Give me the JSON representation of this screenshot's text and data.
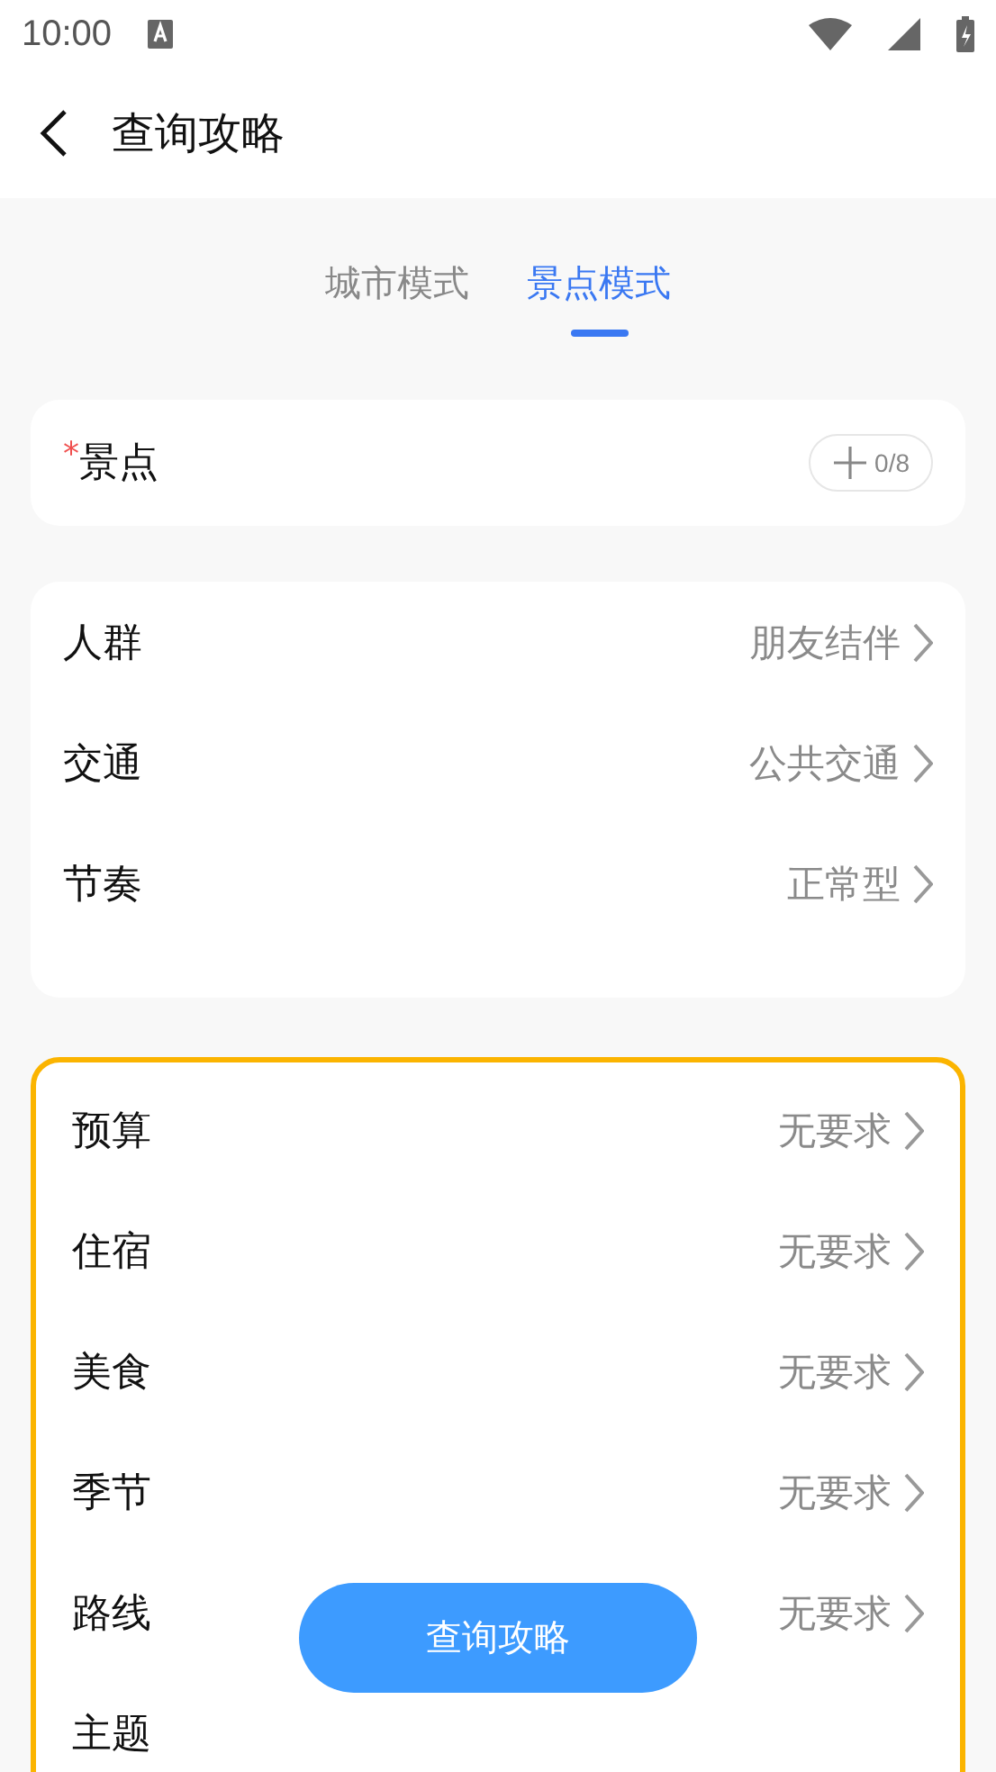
{
  "status_bar": {
    "time": "10:00"
  },
  "header": {
    "title": "查询攻略"
  },
  "tabs": [
    {
      "label": "城市模式",
      "selected": false
    },
    {
      "label": "景点模式",
      "selected": true
    }
  ],
  "spots": {
    "label": "景点",
    "required_mark": "*",
    "count": "0/8"
  },
  "preferences": [
    {
      "label": "人群",
      "value": "朋友结伴"
    },
    {
      "label": "交通",
      "value": "公共交通"
    },
    {
      "label": "节奏",
      "value": "正常型"
    }
  ],
  "requirements": [
    {
      "label": "预算",
      "value": "无要求"
    },
    {
      "label": "住宿",
      "value": "无要求"
    },
    {
      "label": "美食",
      "value": "无要求"
    },
    {
      "label": "季节",
      "value": "无要求"
    },
    {
      "label": "路线",
      "value": "无要求"
    },
    {
      "label": "主题"
    }
  ],
  "action_button": "查询攻略"
}
